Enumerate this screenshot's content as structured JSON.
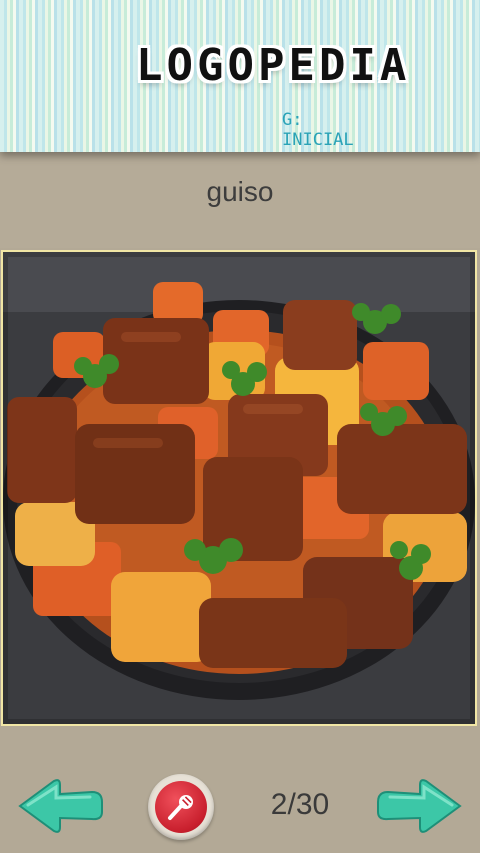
{
  "header": {
    "logo_text": "LOGOPEDIA",
    "subtitle": "G: INICIAL"
  },
  "card": {
    "word": "guiso",
    "image_icon": "food-photo"
  },
  "controls": {
    "previous_icon": "arrow-left-icon",
    "record_icon": "microphone-icon",
    "next_icon": "arrow-right-icon",
    "counter": "2/30"
  },
  "colors": {
    "accent_teal": "#3cc7a7",
    "record_red": "#d42533",
    "subtitle_blue": "#2aa3b7",
    "frame_yellow": "#f1e6a5"
  }
}
